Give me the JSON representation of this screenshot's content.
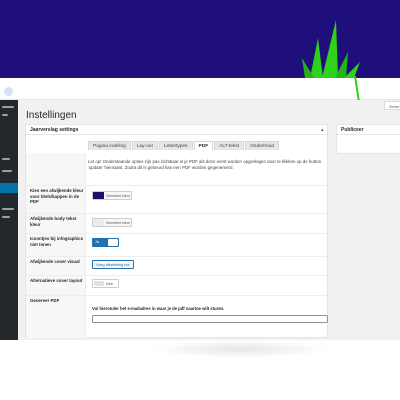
{
  "banner": {
    "color": "#1f0f7a",
    "plant_color": "#2fd11a"
  },
  "browser": {
    "dot_color": "#d5e2f5"
  },
  "header": {
    "title": "Instellingen",
    "screen_options": "Scher"
  },
  "settings_box": {
    "title": "Jaarverslag settings",
    "toggle_icon": "arrow-up-icon",
    "toggle_glyph": "▴"
  },
  "tabs": [
    {
      "label": "Pagina indeling",
      "active": false
    },
    {
      "label": "Lay-out",
      "active": false
    },
    {
      "label": "Lettertypes",
      "active": false
    },
    {
      "label": "PDF",
      "active": true
    },
    {
      "label": "ALT-tekst",
      "active": false
    },
    {
      "label": "Onderhoud",
      "active": false
    }
  ],
  "intro_text": "Let op! Onderstaande opties zijn pas zichtbaar in je PDF als deze eerst worden opgeslagen door te klikken op de button 'update' hiernaast. Zodra dit is gebeurd kan een PDF worden gegenereerd.",
  "fields": {
    "heading_color": {
      "label": "Kies een afwijkende kleur voor titels/kappen in de PDF",
      "button": "Selecteer kleur",
      "value": "#1a0f6e"
    },
    "body_color": {
      "label": "Afwijkende body tekst kleur",
      "button": "Selecteer kleur",
      "value": "#ececec"
    },
    "icons_toggle": {
      "label": "Icoontjes bij infographics niet tonen",
      "state": "Ja"
    },
    "cover_visual": {
      "label": "Afwijkende cover visual",
      "button": "Voeg afbeelding toe"
    },
    "alt_cover": {
      "label": "Alternatieve cover layout",
      "state": "Nee"
    },
    "generate_pdf": {
      "label": "Genereer PDF",
      "help": "Vul hieronder het e-mailadres in waar je de pdf naartoe wilt sturen.",
      "value": ""
    }
  },
  "publish": {
    "title": "Publiceer"
  }
}
